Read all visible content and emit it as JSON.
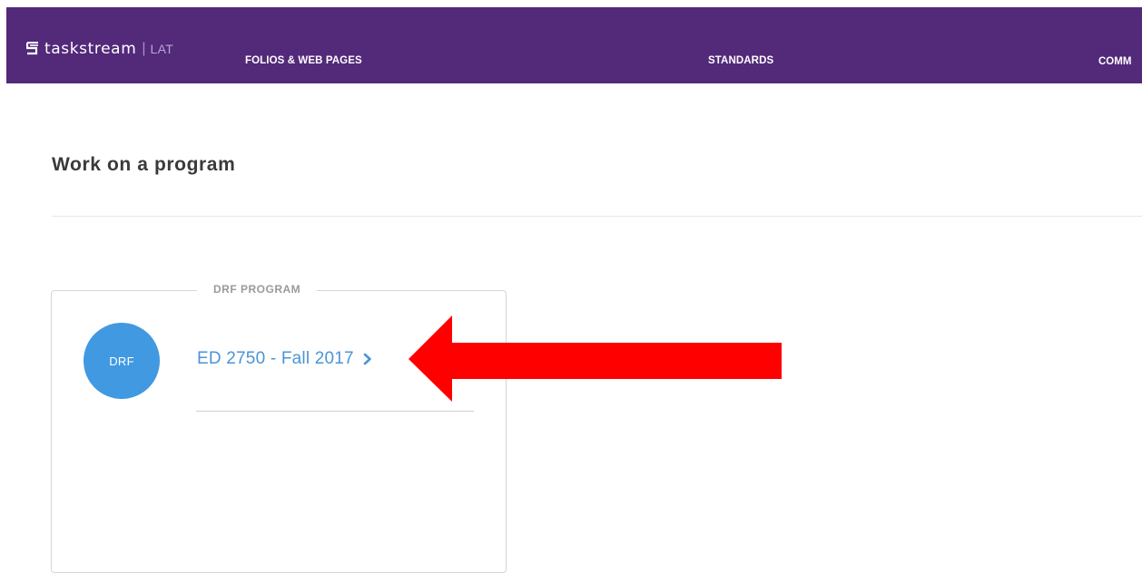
{
  "header": {
    "brand": "taskstream",
    "separator": "|",
    "product": "LAT",
    "nav": [
      {
        "label": "FOLIOS & WEB PAGES"
      },
      {
        "label": "STANDARDS"
      },
      {
        "label": "COMM"
      }
    ]
  },
  "main": {
    "title": "Work on a program",
    "program_card": {
      "legend": "DRF PROGRAM",
      "avatar_text": "DRF",
      "program_link": "ED 2750 - Fall 2017"
    }
  },
  "colors": {
    "header_bg": "#53297a",
    "link": "#4b94d6",
    "avatar": "#4199e1",
    "annotation_arrow": "#ff0000"
  },
  "icons": {
    "logo": "taskstream-logo-icon",
    "chevron": "chevron-right-icon",
    "annotation": "red-arrow-annotation"
  }
}
